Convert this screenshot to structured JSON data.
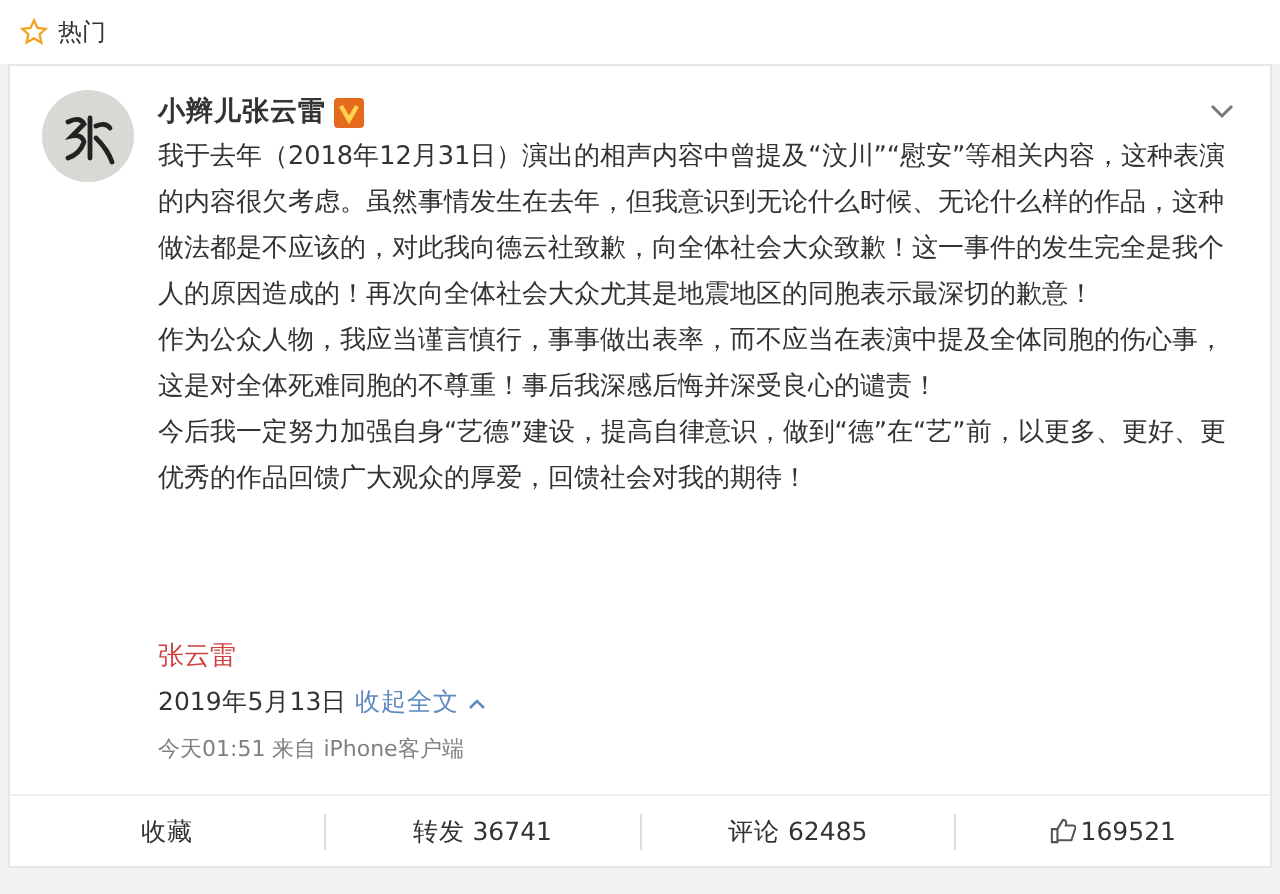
{
  "header": {
    "label": "热门"
  },
  "post": {
    "author": "小辫儿张云雷",
    "paragraphs": [
      "我于去年（2018年12月31日）演出的相声内容中曾提及“汶川”“慰安”等相关内容，这种表演的内容很欠考虑。虽然事情发生在去年，但我意识到无论什么时候、无论什么样的作品，这种做法都是不应该的，对此我向德云社致歉，向全体社会大众致歉！这一事件的发生完全是我个人的原因造成的！再次向全体社会大众尤其是地震地区的同胞表示最深切的歉意！",
      "作为公众人物，我应当谨言慎行，事事做出表率，而不应当在表演中提及全体同胞的伤心事，这是对全体死难同胞的不尊重！事后我深感后悔并深受良心的谴责！",
      "今后我一定努力加强自身“艺德”建设，提高自律意识，做到“德”在“艺”前，以更多、更好、更优秀的作品回馈广大观众的厚爱，回馈社会对我的期待！"
    ],
    "signature": "张云雷",
    "date": "2019年5月13日",
    "collapse_link": "收起全文",
    "source": "今天01:51 来自 iPhone客户端"
  },
  "actions": [
    {
      "kind": "text",
      "label": "收藏"
    },
    {
      "kind": "text",
      "label": "转发 36741"
    },
    {
      "kind": "text",
      "label": "评论 62485"
    },
    {
      "kind": "like",
      "label": "169521"
    }
  ]
}
